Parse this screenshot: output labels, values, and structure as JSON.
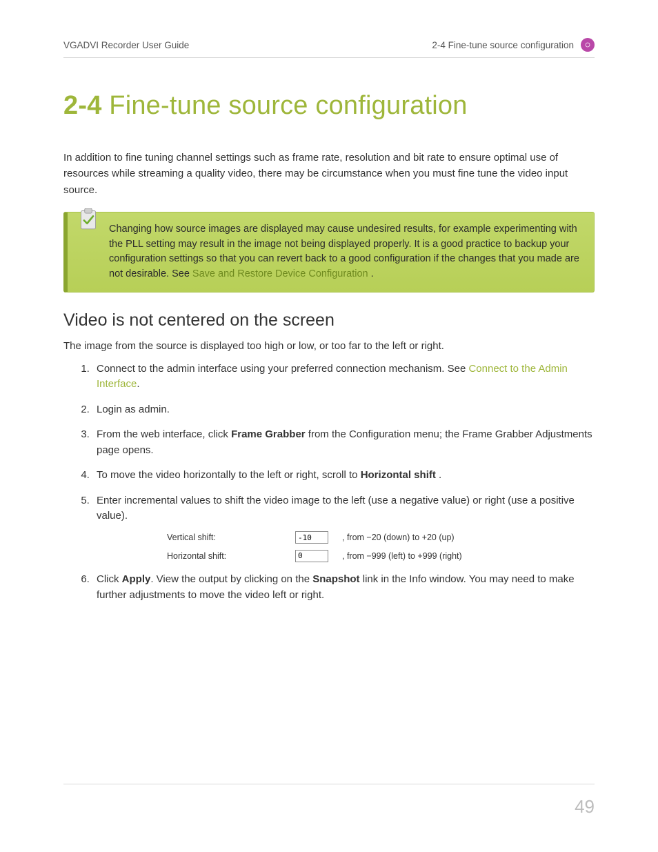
{
  "header": {
    "left": "VGADVI Recorder User Guide",
    "right": "2-4 Fine-tune source configuration"
  },
  "title": {
    "section_number": "2-4",
    "text": "Fine-tune source configuration"
  },
  "intro_paragraph": "In addition to fine tuning channel settings such as frame rate, resolution and bit rate to ensure optimal use of resources while streaming a quality video, there may be circumstance when you must fine tune the video input source.",
  "note": {
    "text_before_link": "Changing how source images are displayed may cause undesired results, for example experimenting with the PLL setting may result in the image not being displayed properly. It is a good practice to backup your configuration settings so that you can revert back to a good configuration if the changes that you made are not desirable. See ",
    "link_text": "Save and Restore Device Configuration",
    "text_after_link": " ."
  },
  "subhead": "Video is not centered on the screen",
  "sub_paragraph": "The image from the source is displayed too high or low, or too far to the left or right.",
  "steps": {
    "s1": {
      "before_link": "Connect to the admin interface using your preferred connection mechanism. See ",
      "link": "Connect to the Admin Interface",
      "after_link": "."
    },
    "s2": "Login as admin.",
    "s3": {
      "before_bold": "From the web interface, click ",
      "bold": "Frame Grabber",
      "after_bold": " from the Configuration menu; the Frame Grabber Adjustments page opens."
    },
    "s4": {
      "before_bold": "To move the video horizontally to the left or right, scroll to ",
      "bold": "Horizontal shift",
      "after_bold": " ."
    },
    "s5": "Enter incremental values to shift the video image to the left (use a negative value) or right (use a positive value).",
    "s6": {
      "p1_before_b1": "Click ",
      "b1": "Apply",
      "p1_mid": ". View the output by clicking on the ",
      "b2": "Snapshot",
      "p1_after": " link in the Info window. You may need to make further adjustments to move the video left or right."
    }
  },
  "shift_form": {
    "row1": {
      "label": "Vertical shift:",
      "value": "-10",
      "hint": ", from −20 (down) to +20 (up)"
    },
    "row2": {
      "label": "Horizontal shift:",
      "value": "0",
      "hint": ", from −999 (left) to +999 (right)"
    }
  },
  "page_number": "49"
}
